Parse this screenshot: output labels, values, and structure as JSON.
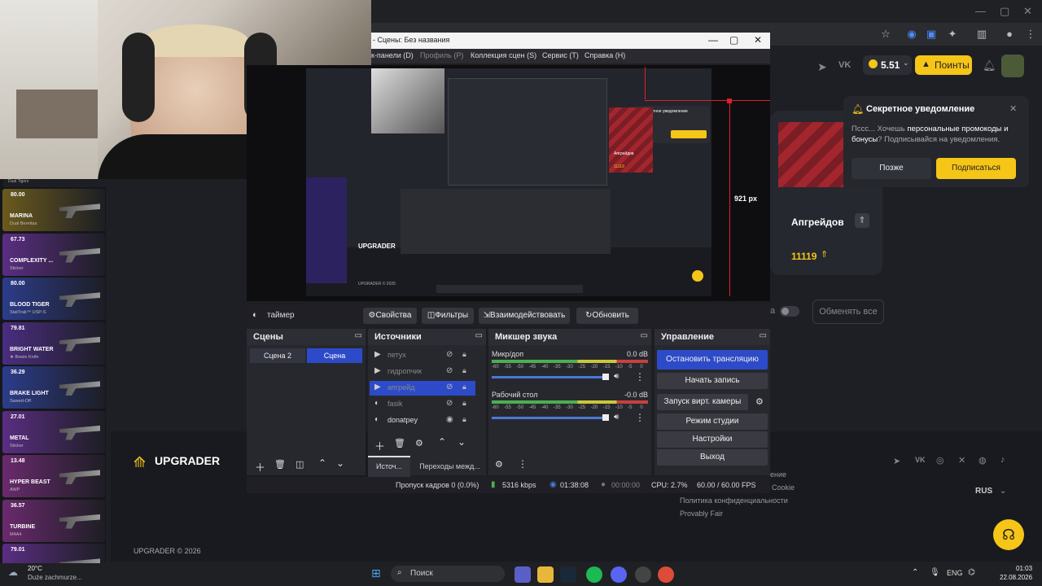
{
  "browser": {
    "win_min": "—",
    "win_max": "▢",
    "win_close": "✕"
  },
  "site": {
    "balance": "5.51",
    "points_label": "Поинты",
    "logo_text": "UPGRADER",
    "copyright": "UPGRADER © 2026",
    "upgrades_label": "Апгрейдов",
    "upgrades_count": "11119",
    "replace_all": "Обменять все",
    "footer_links": [
      "ение",
      "Cookie",
      "Политика конфиденциальности",
      "Provably Fair"
    ],
    "language": "RUS",
    "measure_label": "921 px",
    "toggle_label": "а"
  },
  "notification": {
    "title": "Секретное уведомление",
    "body_prefix": "Пссс... Хочешь ",
    "body_bold1": "персональные промокоды и бонусы",
    "body_suffix": "? Подписывайся на уведомления.",
    "later": "Позже",
    "subscribe": "Подписаться"
  },
  "sidebar": {
    "top_label": "Dual Tigers",
    "skins": [
      {
        "price": "80.00",
        "name": "MARINA",
        "type": "Dual Berettas",
        "color": "#6b5a1e"
      },
      {
        "price": "67.73",
        "name": "COMPLEXITY ...",
        "type": "Sticker",
        "color": "#5a2d82"
      },
      {
        "price": "80.00",
        "name": "BLOOD TIGER",
        "type": "StatTrak™ USP-S",
        "color": "#2c3c8a"
      },
      {
        "price": "79.81",
        "name": "BRIGHT WATER",
        "type": "★ Bowie Knife",
        "color": "#4a2d80"
      },
      {
        "price": "36.29",
        "name": "BRAKE LIGHT",
        "type": "Sawed-Off",
        "color": "#2c3c8a"
      },
      {
        "price": "27.01",
        "name": "METAL",
        "type": "Sticker",
        "color": "#5a2d82"
      },
      {
        "price": "13.48",
        "name": "HYPER BEAST",
        "type": "AWP",
        "color": "#6a2a6e"
      },
      {
        "price": "36.57",
        "name": "TURBINE",
        "type": "M4A4",
        "color": "#6a2a6e"
      },
      {
        "price": "79.01",
        "name": "",
        "type": "",
        "color": "#5a2d82"
      }
    ]
  },
  "obs": {
    "title": "- Сцены: Без названия",
    "menu": [
      "к-панели (D)",
      "Профиль (P)",
      "Коллекция сцен (S)",
      "Сервис (T)",
      "Справка (H)"
    ],
    "source_name": "таймер",
    "toolbar": {
      "properties": "Свойства",
      "filters": "Фильтры",
      "interact": "Взаимодействовать",
      "refresh": "Обновить"
    },
    "scenes": {
      "title": "Сцены",
      "items": [
        "Сцена 2",
        "Сцена"
      ]
    },
    "sources": {
      "title": "Источники",
      "items": [
        "петух",
        "гидропчик",
        "апгрейд",
        "fasik",
        "donatpey"
      ]
    },
    "mixer": {
      "title": "Микшер звука",
      "ch1_name": "Микр/доп",
      "ch1_db": "0.0 dB",
      "ch2_name": "Рабочий стол",
      "ch2_db": "-0.0 dB",
      "scale": [
        "-60",
        "-55",
        "-50",
        "-45",
        "-40",
        "-35",
        "-30",
        "-25",
        "-20",
        "-15",
        "-10",
        "-5",
        "0"
      ]
    },
    "controls": {
      "title": "Управление",
      "stop_stream": "Остановить трансляцию",
      "start_record": "Начать запись",
      "virtual_cam": "Запуск вирт. камеры",
      "studio_mode": "Режим студии",
      "settings": "Настройки",
      "exit": "Выход"
    },
    "tabs": {
      "sources_tab": "Источ...",
      "transitions_tab": "Переходы межд..."
    },
    "status": {
      "dropped": "Пропуск кадров 0 (0.0%)",
      "bitrate": "5316 kbps",
      "stream_time": "01:38:08",
      "record_time": "00:00:00",
      "cpu": "CPU: 2.7%",
      "fps": "60.00 / 60.00 FPS"
    }
  },
  "preview": {
    "logo": "UPGRADER",
    "copyright": "UPGRADER © 2026",
    "notif_title": "Секретное уведомление",
    "upgrades": "Апгрейдов",
    "count": "11119",
    "measure": "921 px"
  },
  "taskbar": {
    "weather_temp": "20°C",
    "weather_desc": "Duże zachmurze...",
    "search": "Поиск",
    "lang": "ENG",
    "time": "01:03",
    "date": "22.08.2026"
  },
  "colors": {
    "accent_yellow": "#f5c518",
    "obs_blue": "#2d4bc8",
    "red_line": "#e0202a"
  }
}
